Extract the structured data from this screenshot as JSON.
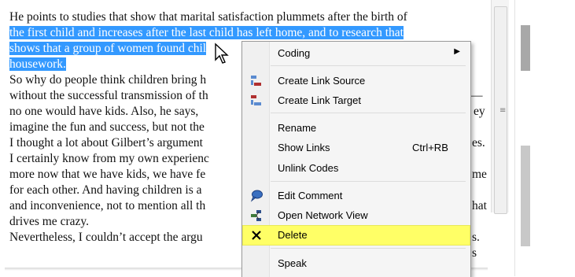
{
  "document": {
    "lines": [
      {
        "text": "He points to studies that show that marital satisfaction plummets after the birth of",
        "selected": false
      },
      {
        "text": "the first child and increases after the last child has left home, and to research that",
        "selected": true
      },
      {
        "text": "shows that a group of women found chil",
        "selected": true
      },
      {
        "text": "housework.",
        "selected": true
      },
      {
        "text": "So why do people think children bring h",
        "selected": false
      },
      {
        "text": "without the successful transmission of th",
        "selected": false
      },
      {
        "text": "no one would have kids. Also, he says, ",
        "selected": false
      },
      {
        "text": "imagine the fun and success, but not the",
        "selected": false
      },
      {
        "text": "I thought a lot about Gilbert’s argument",
        "selected": false
      },
      {
        "text": "I certainly know from my own experienc",
        "selected": false
      },
      {
        "text": "more now that we have kids, we have fe",
        "selected": false
      },
      {
        "text": "for each other. And having children is a ",
        "selected": false
      },
      {
        "text": "and inconvenience, not to mention all th",
        "selected": false
      },
      {
        "text": "drives me crazy.",
        "selected": false
      },
      {
        "text": "Nevertheless, I couldn’t accept the argu",
        "selected": false
      }
    ],
    "right_fragments": [
      "—",
      "ey",
      "es.",
      "me",
      "hat",
      "s.",
      "s"
    ]
  },
  "menu": {
    "items": [
      {
        "label": "Coding",
        "icon": "",
        "shortcut": "",
        "submenu": true
      },
      {
        "label": "Create Link Source",
        "icon": "link-source-icon"
      },
      {
        "label": "Create Link Target",
        "icon": "link-target-icon"
      },
      {
        "label": "Rename"
      },
      {
        "label": "Show Links",
        "shortcut": "Ctrl+RB"
      },
      {
        "label": "Unlink Codes"
      },
      {
        "label": "Edit Comment",
        "icon": "comment-icon"
      },
      {
        "label": "Open Network View",
        "icon": "network-icon"
      },
      {
        "label": "Delete",
        "icon": "delete-icon",
        "highlighted": true
      },
      {
        "label": "Speak"
      }
    ],
    "highlight_color": "#ffff66"
  },
  "colors": {
    "selection": "#3399ff",
    "link_icon": "#2b6cb0",
    "comment_icon": "#2a5aa8",
    "delete_icon": "#000000"
  }
}
